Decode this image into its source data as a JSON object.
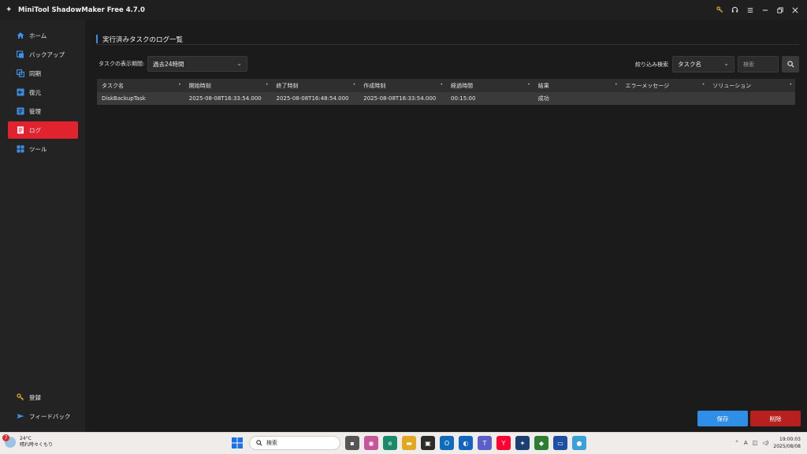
{
  "window": {
    "title": "MiniTool ShadowMaker Free 4.7.0",
    "controls": [
      "key-icon",
      "headset-icon",
      "menu-icon",
      "minimize-icon",
      "restore-icon",
      "close-icon"
    ]
  },
  "sidebar": {
    "items": [
      {
        "label": "ホーム",
        "icon": "home-icon"
      },
      {
        "label": "バックアップ",
        "icon": "backup-icon"
      },
      {
        "label": "同期",
        "icon": "sync-icon"
      },
      {
        "label": "復元",
        "icon": "restore-icon"
      },
      {
        "label": "管理",
        "icon": "manage-icon"
      },
      {
        "label": "ログ",
        "icon": "log-icon",
        "active": true
      },
      {
        "label": "ツール",
        "icon": "tools-icon"
      }
    ],
    "bottom": [
      {
        "label": "登録",
        "icon": "key-icon"
      },
      {
        "label": "フィードバック",
        "icon": "mail-icon"
      }
    ]
  },
  "main": {
    "title": "実行済みタスクのログ一覧",
    "period_label": "タスクの表示期間:",
    "period_value": "過去24時間",
    "filter_label": "絞り込み検索",
    "filter_value": "タスク名",
    "search_placeholder": "検索",
    "table": {
      "columns": [
        "タスク名",
        "開始時刻",
        "終了時刻",
        "作成時刻",
        "経過時間",
        "結果",
        "エラーメッセージ",
        "ソリューション"
      ],
      "rows": [
        [
          "DiskBackupTask",
          "2025-08-08T16:33:54.000",
          "2025-08-08T16:48:54.000",
          "2025-08-08T16:33:54.000",
          "00:15:00",
          "成功",
          "",
          ""
        ]
      ]
    },
    "save_label": "保存",
    "delete_label": "削除"
  },
  "taskbar": {
    "weather_temp": "24°C",
    "weather_desc": "晴れ時々くもり",
    "weather_badge": "7",
    "search_placeholder": "検索",
    "time": "19:00:03",
    "date": "2025/08/08"
  },
  "colors": {
    "accent_red": "#e0232f",
    "save_blue": "#2f8ee6",
    "delete_red": "#b8201f",
    "title_marker": "#3c8ce7"
  }
}
